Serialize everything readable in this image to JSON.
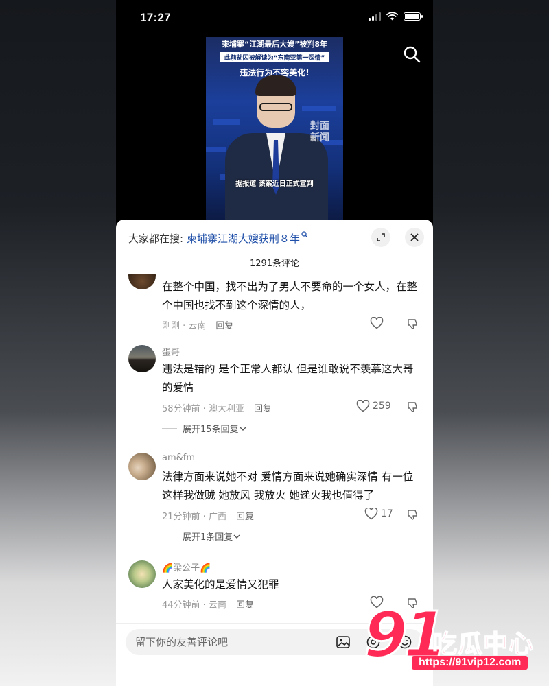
{
  "status_bar": {
    "time": "17:27"
  },
  "video": {
    "headline_line1": "柬埔寨“江湖最后大嫂”被判8年",
    "headline_line2": "此前劫囚被解读为“东南亚第一深情”",
    "headline_line3": "违法行为不容美化!",
    "watermark": "封面新闻",
    "subtitle": "据报道 该案近日正式宣判"
  },
  "sheet": {
    "suggest_prefix": "大家都在搜:",
    "suggest_term": "柬埔寨江湖大嫂获刑８年",
    "comment_count": "1291条评论"
  },
  "comments": [
    {
      "user": "",
      "text": "在整个中国，找不出为了男人不要命的一个女人，在整个中国也找不到这个深情的人，",
      "time_location": "刚刚 · 云南",
      "reply_label": "回复",
      "likes": ""
    },
    {
      "user": "蛋哥",
      "text": "违法是错的 是个正常人都认 但是谁敢说不羡慕这大哥的爱情",
      "time_location": "58分钟前 · 澳大利亚",
      "reply_label": "回复",
      "likes": "259",
      "expand_label": "展开15条回复"
    },
    {
      "user": "am&fm",
      "text": "法律方面来说她不对 爱情方面来说她确实深情 有一位这样我做贼 她放风 我放火 她递火我也值得了",
      "time_location": "21分钟前 · 广西",
      "reply_label": "回复",
      "likes": "17",
      "expand_label": "展开1条回复"
    },
    {
      "user": "🌈梁公子🌈",
      "text": "人家美化的是爱情又犯罪",
      "time_location": "44分钟前 · 云南",
      "reply_label": "回复",
      "likes": ""
    }
  ],
  "input": {
    "placeholder": "留下你的友善评论吧"
  },
  "logo": {
    "number": "91",
    "name": "吃瓜中心",
    "url": "https://91vip12.com"
  },
  "colors": {
    "link_blue": "#1f4fa8",
    "logo_red": "#ff2a55",
    "sheet_bg": "#ffffff"
  }
}
